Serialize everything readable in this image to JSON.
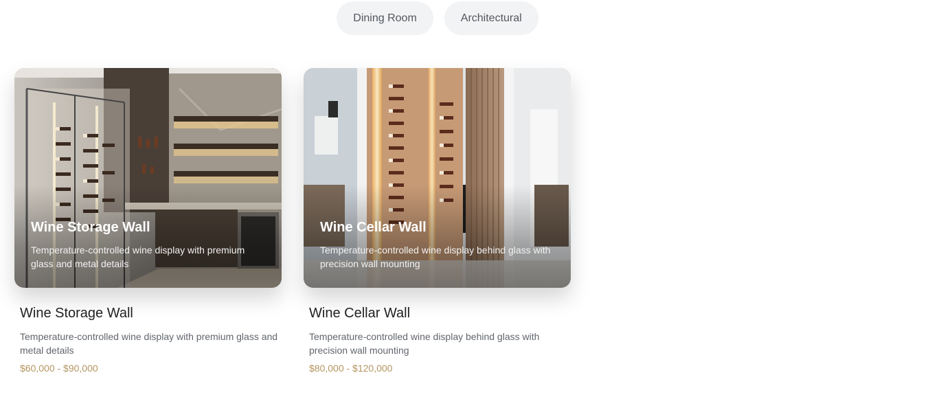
{
  "filters": [
    {
      "label": "Dining Room"
    },
    {
      "label": "Architectural"
    }
  ],
  "cards": [
    {
      "title": "Wine Storage Wall",
      "description": "Temperature-controlled wine display with premium glass and metal details",
      "price": "$60,000 - $90,000"
    },
    {
      "title": "Wine Cellar Wall",
      "description": "Temperature-controlled wine display behind glass with precision wall mounting",
      "price": "$80,000 - $120,000"
    }
  ],
  "colors": {
    "pill_bg": "#f2f3f5",
    "pill_text": "#52565e",
    "price": "#b49561",
    "title": "#222222"
  }
}
